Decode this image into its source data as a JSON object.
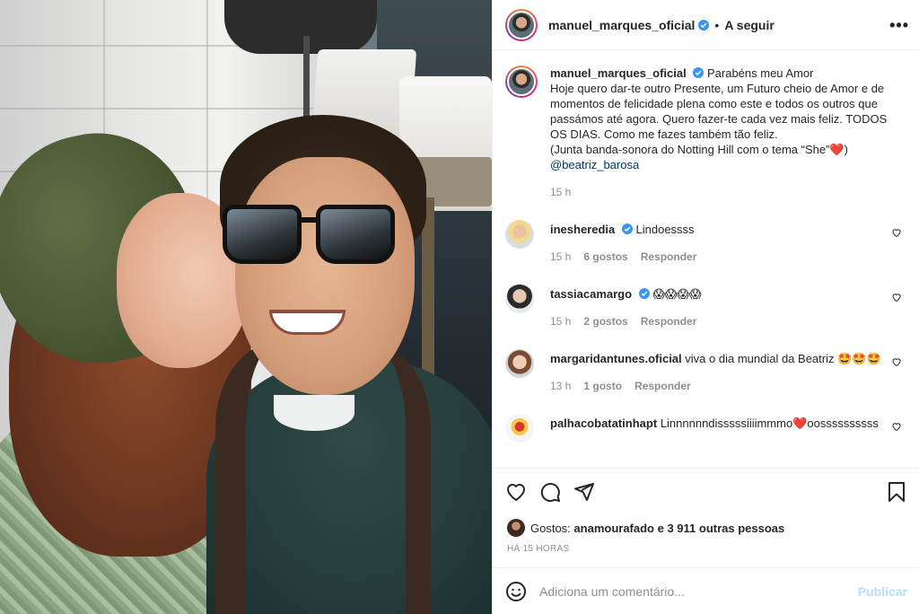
{
  "header": {
    "username": "manuel_marques_oficial",
    "separator": "•",
    "follow_label": "A seguir",
    "more_label": "•••"
  },
  "caption": {
    "username": "manuel_marques_oficial",
    "lines": [
      "Parabéns meu Amor",
      "Hoje quero dar-te outro Presente, um Futuro cheio de Amor e de momentos de felicidade plena como este e todos os outros que passámos até agora. Quero fazer-te cada vez mais feliz. TODOS OS DIAS. Como me fazes também tão feliz.",
      "(Junta banda-sonora do Notting Hill com o tema “She”❤️)"
    ],
    "mention": "@beatriz_barosa",
    "time": "15 h"
  },
  "comments": [
    {
      "username": "inesheredia",
      "verified": true,
      "text": "Lindoessss",
      "time": "15 h",
      "likes": "6 gostos",
      "reply": "Responder"
    },
    {
      "username": "tassiacamargo",
      "verified": true,
      "text": "😱😱😱😱",
      "time": "15 h",
      "likes": "2 gostos",
      "reply": "Responder"
    },
    {
      "username": "margaridantunes.oficial",
      "verified": false,
      "text": "viva o dia mundial da Beatriz 🤩🤩🤩",
      "time": "13 h",
      "likes": "1 gosto",
      "reply": "Responder"
    },
    {
      "username": "palhacobatatinhapt",
      "verified": false,
      "text": "Linnnnnndisssssiiiimmmo❤️oossssssssss",
      "time": "",
      "likes": "",
      "reply": ""
    }
  ],
  "likes": {
    "prefix": "Gostos:",
    "user": "anamourafado",
    "rest": "e 3 911 outras pessoas"
  },
  "posted_time": "HÁ 15 HORAS",
  "comment_box": {
    "placeholder": "Adiciona um comentário...",
    "publish_label": "Publicar"
  },
  "colors": {
    "verified": "#3897f0",
    "link": "#00376b",
    "publish_disabled": "#b2dffc",
    "muted": "#8e8e8e"
  }
}
